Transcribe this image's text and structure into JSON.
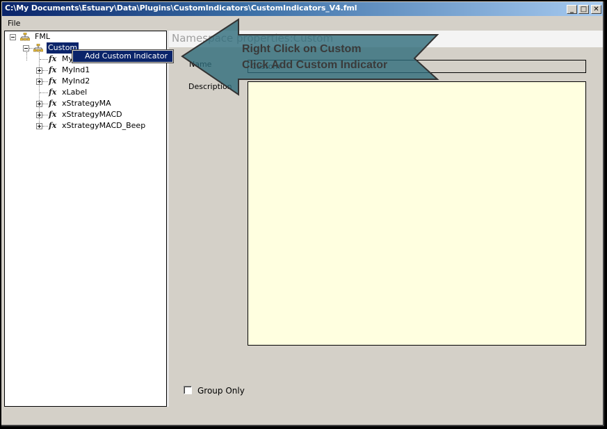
{
  "window": {
    "title": "C:\\My Documents\\Estuary\\Data\\Plugins\\CustomIndicators\\CustomIndicators_V4.fml",
    "controls": {
      "minimize": "_",
      "maximize": "□",
      "close": "✕"
    }
  },
  "menubar": {
    "items": [
      {
        "label": "File"
      }
    ]
  },
  "tree": {
    "root": {
      "label": "FML",
      "icon": "namespace-icon",
      "expanded": true
    },
    "selected": {
      "label": "Custom",
      "icon": "namespace-icon",
      "expanded": true
    },
    "items": [
      {
        "label": "My",
        "icon": "function-icon",
        "expandable": false
      },
      {
        "label": "MyInd1",
        "icon": "function-icon",
        "expandable": true
      },
      {
        "label": "MyInd2",
        "icon": "function-icon",
        "expandable": true
      },
      {
        "label": "xLabel",
        "icon": "function-icon",
        "expandable": false
      },
      {
        "label": "xStrategyMA",
        "icon": "function-icon",
        "expandable": true
      },
      {
        "label": "xStrategyMACD",
        "icon": "function-icon",
        "expandable": true
      },
      {
        "label": "xStrategyMACD_Beep",
        "icon": "function-icon",
        "expandable": true
      }
    ],
    "fx_glyph": "fx"
  },
  "context_menu": {
    "items": [
      {
        "label": "Add Custom Indicator",
        "highlighted": true
      }
    ]
  },
  "properties": {
    "header": "Namespace properties:Custom",
    "name_label": "Name",
    "name_value": "Custom",
    "description_label": "Description",
    "description_value": "",
    "group_only_label": "Group Only",
    "group_only_checked": false
  },
  "annotation": {
    "line1": "Right Click on Custom",
    "line2": "Click Add Custom Indicator",
    "arrow_color": "#2e6b7a"
  },
  "colors": {
    "titlebar_start": "#0a246a",
    "titlebar_end": "#a6caf0",
    "selection": "#0a246a",
    "description_bg": "#ffffe0",
    "window_bg": "#d4d0c8"
  }
}
